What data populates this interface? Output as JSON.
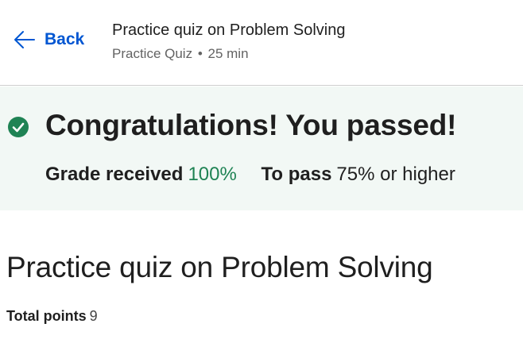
{
  "header": {
    "back_label": "Back",
    "title": "Practice quiz on Problem Solving",
    "item_type": "Practice Quiz",
    "separator": "•",
    "duration": "25 min"
  },
  "result": {
    "title": "Congratulations! You passed!",
    "grade_label": "Grade received",
    "grade_value": "100%",
    "pass_label": "To pass",
    "pass_value": "75% or higher",
    "status_color": "#1f8354"
  },
  "quiz": {
    "title": "Practice quiz on Problem Solving",
    "total_points_label": "Total points",
    "total_points_value": "9"
  },
  "colors": {
    "link": "#0056d2",
    "banner_bg": "#f2f8f5",
    "success": "#1f8354"
  },
  "icons": {
    "back": "arrow-left-icon",
    "status": "check-circle-icon"
  }
}
